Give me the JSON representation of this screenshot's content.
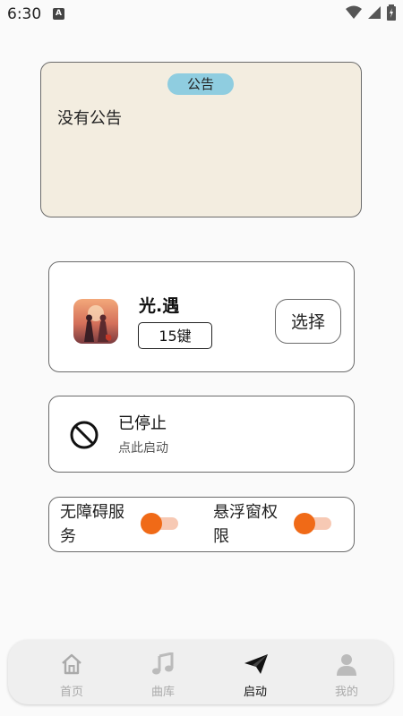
{
  "status_bar": {
    "time": "6:30",
    "notification_letter": "A"
  },
  "notice": {
    "tag": "公告",
    "text": "没有公告"
  },
  "game": {
    "title": "光.遇",
    "keys_badge": "15键",
    "select_label": "选择"
  },
  "run_status": {
    "title": "已停止",
    "subtitle": "点此启动"
  },
  "permissions": [
    {
      "label": "无障碍服务",
      "enabled": false
    },
    {
      "label": "悬浮窗权限",
      "enabled": false
    }
  ],
  "nav": [
    {
      "label": "首页",
      "icon": "home-icon",
      "active": false
    },
    {
      "label": "曲库",
      "icon": "music-note-icon",
      "active": false
    },
    {
      "label": "启动",
      "icon": "paper-plane-icon",
      "active": true
    },
    {
      "label": "我的",
      "icon": "person-icon",
      "active": false
    }
  ],
  "colors": {
    "accent": "#f06a17",
    "notice_bg": "#f3ede0",
    "notice_tag": "#8fcde0",
    "nav_inactive": "#aaaaaa"
  }
}
